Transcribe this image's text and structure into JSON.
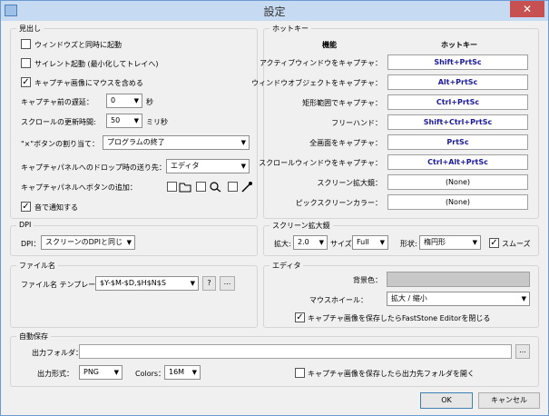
{
  "window": {
    "title": "設定",
    "close_label": "✕"
  },
  "capture": {
    "title": "見出し",
    "startup_with_windows": "ウィンドウズと同時に起動",
    "silent_startup": "サイレント起動 (最小化してトレイへ)",
    "include_mouse": "キャプチャ画像にマウスを含める",
    "delay_label": "キャプチャ前の遅延：",
    "delay_value": "0",
    "delay_unit": "秒",
    "scroll_label": "スクロールの更新時間:",
    "scroll_value": "50",
    "scroll_unit": "ミリ秒",
    "x_button_label": "\"×\"ボタンの割り当て：",
    "x_button_value": "プログラムの終了",
    "drop_label": "キャプチャパネルへのドロップ時の送り先：",
    "drop_value": "エディタ",
    "add_button_label": "キャプチャパネルへボタンの追加：",
    "sound_notify": "音で通知する"
  },
  "hotkeys": {
    "title": "ホットキー",
    "col_function": "機能",
    "col_hotkey": "ホットキー",
    "rows": [
      {
        "label": "アクティブウィンドウをキャプチャ：",
        "key": "Shift+PrtSc"
      },
      {
        "label": "ウィンドウオブジェクトをキャプチャ：",
        "key": "Alt+PrtSc"
      },
      {
        "label": "矩形範囲でキャプチャ：",
        "key": "Ctrl+PrtSc"
      },
      {
        "label": "フリーハンド：",
        "key": "Shift+Ctrl+PrtSc"
      },
      {
        "label": "全画面をキャプチャ：",
        "key": "PrtSc"
      },
      {
        "label": "スクロールウィンドウをキャプチャ：",
        "key": "Ctrl+Alt+PrtSc"
      },
      {
        "label": "スクリーン拡大鏡：",
        "key": "(None)"
      },
      {
        "label": "ピックスクリーンカラー：",
        "key": "(None)"
      }
    ]
  },
  "dpi": {
    "title": "DPI",
    "label": "DPI：",
    "value": "スクリーンのDPIと同じ"
  },
  "magnifier": {
    "title": "スクリーン拡大鏡",
    "zoom_label": "拡大:",
    "zoom_value": "2.0",
    "size_label": "サイズ:",
    "size_value": "Full",
    "shape_label": "形状:",
    "shape_value": "楕円形",
    "smooth": "スムーズ"
  },
  "filename": {
    "title": "ファイル名",
    "label": "ファイル名 テンプレート：",
    "value": "$Y-$M-$D,$H$N$S",
    "help": "?",
    "browse": "..."
  },
  "editor": {
    "title": "エディタ",
    "bg_label": "背景色：",
    "wheel_label": "マウスホイール：",
    "wheel_value": "拡大 / 縮小",
    "close_on_save": "キャプチャ画像を保存したらFastStone Editorを閉じる"
  },
  "autosave": {
    "title": "自動保存",
    "folder_label": "出力フォルダ：",
    "folder_value": "",
    "browse": "...",
    "format_label": "出力形式：",
    "format_value": "PNG",
    "colors_label": "Colors：",
    "colors_value": "16M",
    "open_folder": "キャプチャ画像を保存したら出力先フォルダを開く"
  },
  "buttons": {
    "ok": "OK",
    "cancel": "キャンセル"
  },
  "colors": {
    "accent": "#1a1a9c",
    "editor_bg": "#c8c8c8"
  }
}
